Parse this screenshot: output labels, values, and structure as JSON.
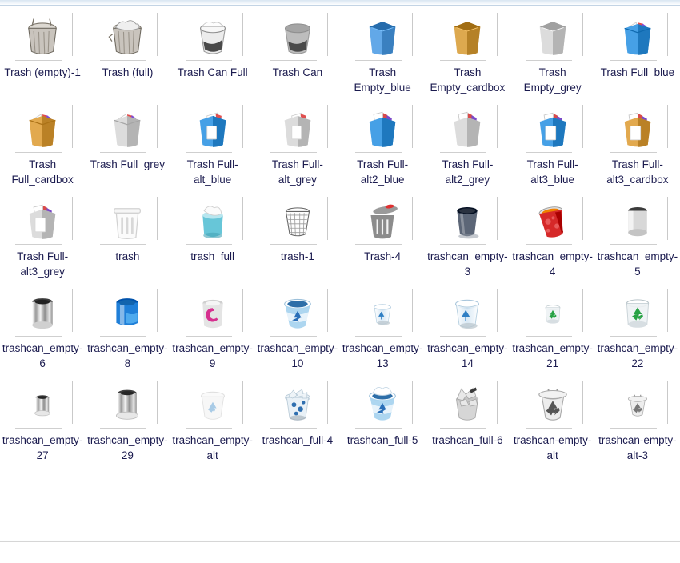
{
  "window": {
    "title": "Trash Icon Gallery",
    "background_color": "#ffffff",
    "label_color": "#1b1b4f",
    "top_strip_color": "#d9e6f2"
  },
  "grid": {
    "columns": 8,
    "rows": 5,
    "item_count": 40,
    "items": [
      {
        "label": "Trash (empty)-1",
        "icon": "metal-can-lid-empty-icon",
        "style": "metal_can",
        "colors": {
          "body": "#c9c4bd",
          "accent": "#8a8378"
        }
      },
      {
        "label": "Trash (full)",
        "icon": "metal-can-full-icon",
        "style": "metal_can_full",
        "colors": {
          "body": "#c9c4bd",
          "accent": "#8a8378"
        }
      },
      {
        "label": "Trash Can Full",
        "icon": "bucket-full-white-icon",
        "style": "bucket_full",
        "colors": {
          "body": "#e9e9e9",
          "accent": "#4a4a4a"
        }
      },
      {
        "label": "Trash Can",
        "icon": "bucket-grey-icon",
        "style": "bucket_grey",
        "colors": {
          "body": "#b9b9b9",
          "accent": "#4a4a4a"
        }
      },
      {
        "label": "Trash Empty_blue",
        "icon": "box-empty-blue-icon",
        "style": "box_empty",
        "colors": {
          "body": "#62a8e8",
          "accent": "#2d6fa8"
        }
      },
      {
        "label": "Trash Empty_cardbox",
        "icon": "box-empty-cardboard-icon",
        "style": "box_empty",
        "colors": {
          "body": "#dda94f",
          "accent": "#9d7128"
        }
      },
      {
        "label": "Trash Empty_grey",
        "icon": "box-empty-grey-icon",
        "style": "box_empty",
        "colors": {
          "body": "#dcdcdc",
          "accent": "#8e8e8e"
        }
      },
      {
        "label": "Trash Full_blue",
        "icon": "box-full-blue-icon",
        "style": "box_full",
        "colors": {
          "body": "#46a0e6",
          "accent": "#2d6fa8"
        }
      },
      {
        "label": "Trash Full_cardbox",
        "icon": "box-full-cardboard-icon",
        "style": "box_full",
        "colors": {
          "body": "#e2a94e",
          "accent": "#9d7128"
        }
      },
      {
        "label": "Trash Full_grey",
        "icon": "box-full-grey-icon",
        "style": "box_full",
        "colors": {
          "body": "#dcdcdc",
          "accent": "#8e8e8e"
        }
      },
      {
        "label": "Trash Full-alt_blue",
        "icon": "box-full-alt-blue-icon",
        "style": "box_alt",
        "colors": {
          "body": "#46a0e6",
          "accent": "#2d6fa8"
        }
      },
      {
        "label": "Trash Full-alt_grey",
        "icon": "box-full-alt-grey-icon",
        "style": "box_alt",
        "colors": {
          "body": "#dcdcdc",
          "accent": "#8e8e8e"
        }
      },
      {
        "label": "Trash Full-alt2_blue",
        "icon": "box-full-alt2-blue-icon",
        "style": "box_alt2",
        "colors": {
          "body": "#46a0e6",
          "accent": "#2d6fa8"
        }
      },
      {
        "label": "Trash Full-alt2_grey",
        "icon": "box-full-alt2-grey-icon",
        "style": "box_alt2",
        "colors": {
          "body": "#dcdcdc",
          "accent": "#8e8e8e"
        }
      },
      {
        "label": "Trash Full-alt3_blue",
        "icon": "box-full-alt3-blue-icon",
        "style": "box_alt3",
        "colors": {
          "body": "#46a0e6",
          "accent": "#2d6fa8"
        }
      },
      {
        "label": "Trash Full-alt3_cardbox",
        "icon": "box-full-alt3-cardboard-icon",
        "style": "box_alt3",
        "colors": {
          "body": "#e2a94e",
          "accent": "#9d7128"
        }
      },
      {
        "label": "Trash Full-alt3_grey",
        "icon": "box-full-alt3-grey-icon",
        "style": "box_alt3",
        "colors": {
          "body": "#dcdcdc",
          "accent": "#8e8e8e"
        }
      },
      {
        "label": "trash",
        "icon": "outline-bin-icon",
        "style": "outline_bin",
        "colors": {
          "body": "#f2f2f2",
          "accent": "#cfcfcf"
        }
      },
      {
        "label": "trash_full",
        "icon": "cyan-can-full-icon",
        "style": "cyan_full",
        "colors": {
          "body": "#67c6d8",
          "accent": "#2e8ba0"
        }
      },
      {
        "label": "trash-1",
        "icon": "wire-mesh-basket-icon",
        "style": "mesh_basket",
        "colors": {
          "body": "#ffffff",
          "accent": "#555555"
        }
      },
      {
        "label": "Trash-4",
        "icon": "grey-bin-red-lid-icon",
        "style": "grey_bin_lid",
        "colors": {
          "body": "#8c8c8c",
          "accent": "#e03030"
        }
      },
      {
        "label": "trashcan_empty-3",
        "icon": "dark-glass-bin-icon",
        "style": "dark_glass",
        "colors": {
          "body": "#4a5568",
          "accent": "#2a3240"
        }
      },
      {
        "label": "trashcan_empty-4",
        "icon": "red-graffiti-bin-icon",
        "style": "red_bin",
        "colors": {
          "body": "#d62828",
          "accent": "#f08000"
        }
      },
      {
        "label": "trashcan_empty-5",
        "icon": "plain-silver-cylinder-icon",
        "style": "silver_cyl",
        "colors": {
          "body": "#d8d8d8",
          "accent": "#3b3b3b"
        }
      },
      {
        "label": "trashcan_empty-6",
        "icon": "steel-cylinder-icon",
        "style": "steel_cyl",
        "colors": {
          "body": "#cfcfcf",
          "accent": "#4a4a4a"
        }
      },
      {
        "label": "trashcan_empty-8",
        "icon": "blue-cylinder-icon",
        "style": "blue_cyl",
        "colors": {
          "body": "#1f7fd8",
          "accent": "#0d4f8f"
        }
      },
      {
        "label": "trashcan_empty-9",
        "icon": "debian-swirl-bin-icon",
        "style": "debian_bin",
        "colors": {
          "body": "#e4e4e4",
          "accent": "#d6308f"
        }
      },
      {
        "label": "trashcan_empty-10",
        "icon": "blue-recycle-bin-icon",
        "style": "blue_recycle",
        "colors": {
          "body": "#a9d4ef",
          "accent": "#1b6fb5"
        }
      },
      {
        "label": "trashcan_empty-13",
        "icon": "small-glass-recycle-bin-icon",
        "style": "glass_recycle_s",
        "colors": {
          "body": "#dcebf7",
          "accent": "#2f7fc4"
        }
      },
      {
        "label": "trashcan_empty-14",
        "icon": "glass-recycle-bin-icon",
        "style": "glass_recycle",
        "colors": {
          "body": "#dcebf7",
          "accent": "#2f7fc4"
        }
      },
      {
        "label": "trashcan_empty-21",
        "icon": "small-green-recycle-bin-icon",
        "style": "green_recycle_s",
        "colors": {
          "body": "#eef2f4",
          "accent": "#27a244"
        }
      },
      {
        "label": "trashcan_empty-22",
        "icon": "green-recycle-bin-icon",
        "style": "green_recycle",
        "colors": {
          "body": "#eef2f4",
          "accent": "#27a244"
        }
      },
      {
        "label": "trashcan_empty-27",
        "icon": "small-chrome-bin-icon",
        "style": "chrome_bin_s",
        "colors": {
          "body": "#dedede",
          "accent": "#666666"
        }
      },
      {
        "label": "trashcan_empty-29",
        "icon": "chrome-bin-icon",
        "style": "chrome_bin",
        "colors": {
          "body": "#dedede",
          "accent": "#666666"
        }
      },
      {
        "label": "trashcan_empty-alt",
        "icon": "faint-recycle-bin-icon",
        "style": "faint_recycle",
        "colors": {
          "body": "#f4f4f4",
          "accent": "#9cc4e4"
        }
      },
      {
        "label": "trashcan_full-4",
        "icon": "overflowing-paper-bin-icon",
        "style": "paper_full",
        "colors": {
          "body": "#e6eef5",
          "accent": "#2f6fb0"
        }
      },
      {
        "label": "trashcan_full-5",
        "icon": "blue-recycle-bin-full-icon",
        "style": "blue_recycle_f",
        "colors": {
          "body": "#a9d4ef",
          "accent": "#1b6fb5"
        }
      },
      {
        "label": "trashcan_full-6",
        "icon": "grey-paper-full-bin-icon",
        "style": "grey_paper_full",
        "colors": {
          "body": "#cfcfcf",
          "accent": "#8a8a8a"
        }
      },
      {
        "label": "trashcan-empty-alt",
        "icon": "recycle-bin-lid-icon",
        "style": "recycle_lid",
        "colors": {
          "body": "#e8e8e8",
          "accent": "#555555"
        }
      },
      {
        "label": "trashcan-empty-alt-3",
        "icon": "small-recycle-bin-lid-icon",
        "style": "recycle_lid_s",
        "colors": {
          "body": "#f0f0f0",
          "accent": "#777777"
        }
      }
    ]
  }
}
